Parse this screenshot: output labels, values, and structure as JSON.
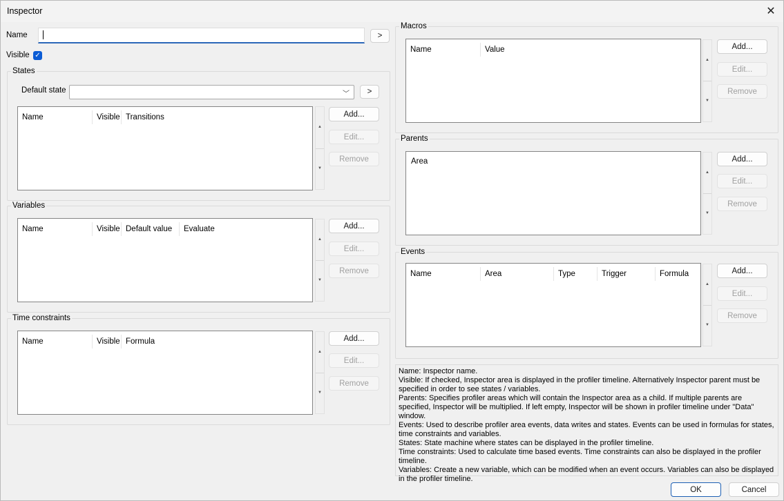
{
  "window": {
    "title": "Inspector"
  },
  "name_row": {
    "label": "Name",
    "value": "",
    "go_label": ">"
  },
  "visible_row": {
    "label": "Visible",
    "checked": true,
    "check_glyph": "✓"
  },
  "states": {
    "title": "States",
    "default_state_label": "Default state",
    "default_state_value": "",
    "go_label": ">",
    "columns": [
      "Name",
      "Visible",
      "Transitions"
    ],
    "add": "Add...",
    "edit": "Edit...",
    "remove": "Remove"
  },
  "variables": {
    "title": "Variables",
    "columns": [
      "Name",
      "Visible",
      "Default value",
      "Evaluate"
    ],
    "add": "Add...",
    "edit": "Edit...",
    "remove": "Remove"
  },
  "time_constraints": {
    "title": "Time constraints",
    "columns": [
      "Name",
      "Visible",
      "Formula"
    ],
    "add": "Add...",
    "edit": "Edit...",
    "remove": "Remove"
  },
  "macros": {
    "title": "Macros",
    "columns": [
      "Name",
      "Value"
    ],
    "add": "Add...",
    "edit": "Edit...",
    "remove": "Remove"
  },
  "parents": {
    "title": "Parents",
    "items": [
      "Area"
    ],
    "add": "Add...",
    "edit": "Edit...",
    "remove": "Remove"
  },
  "events": {
    "title": "Events",
    "columns": [
      "Name",
      "Area",
      "Type",
      "Trigger",
      "Formula"
    ],
    "add": "Add...",
    "edit": "Edit...",
    "remove": "Remove"
  },
  "scroll": {
    "up": "▲",
    "down": "▼"
  },
  "help_lines": [
    "Name: Inspector name.",
    "Visible: If checked, Inspector area is displayed in the profiler timeline. Alternatively Inspector parent must be specified in order to see states / variables.",
    "Parents: Specifies profiler areas which will contain the Inspector area as a child. If multiple parents are specified, Inspector will be multiplied. If left empty, Inspector will be shown in profiler timeline under \"Data\" window.",
    "Events: Used to describe profiler area events, data writes and states. Events can be used in formulas for states, time constraints and variables.",
    "States: State machine where states can be displayed in the profiler timeline.",
    "Time constraints: Used to calculate time based events. Time constraints can also be displayed in the profiler timeline.",
    "Variables: Create a new variable, which can be modified when an event occurs. Variables can also be displayed in the profiler timeline."
  ],
  "footer": {
    "ok": "OK",
    "cancel": "Cancel"
  },
  "icons": {
    "close": "close-icon",
    "check": "checkmark-icon",
    "dropdown": "chevron-down-icon"
  },
  "colors": {
    "accent": "#0b5cd5",
    "focus_underline": "#2a67b8"
  }
}
